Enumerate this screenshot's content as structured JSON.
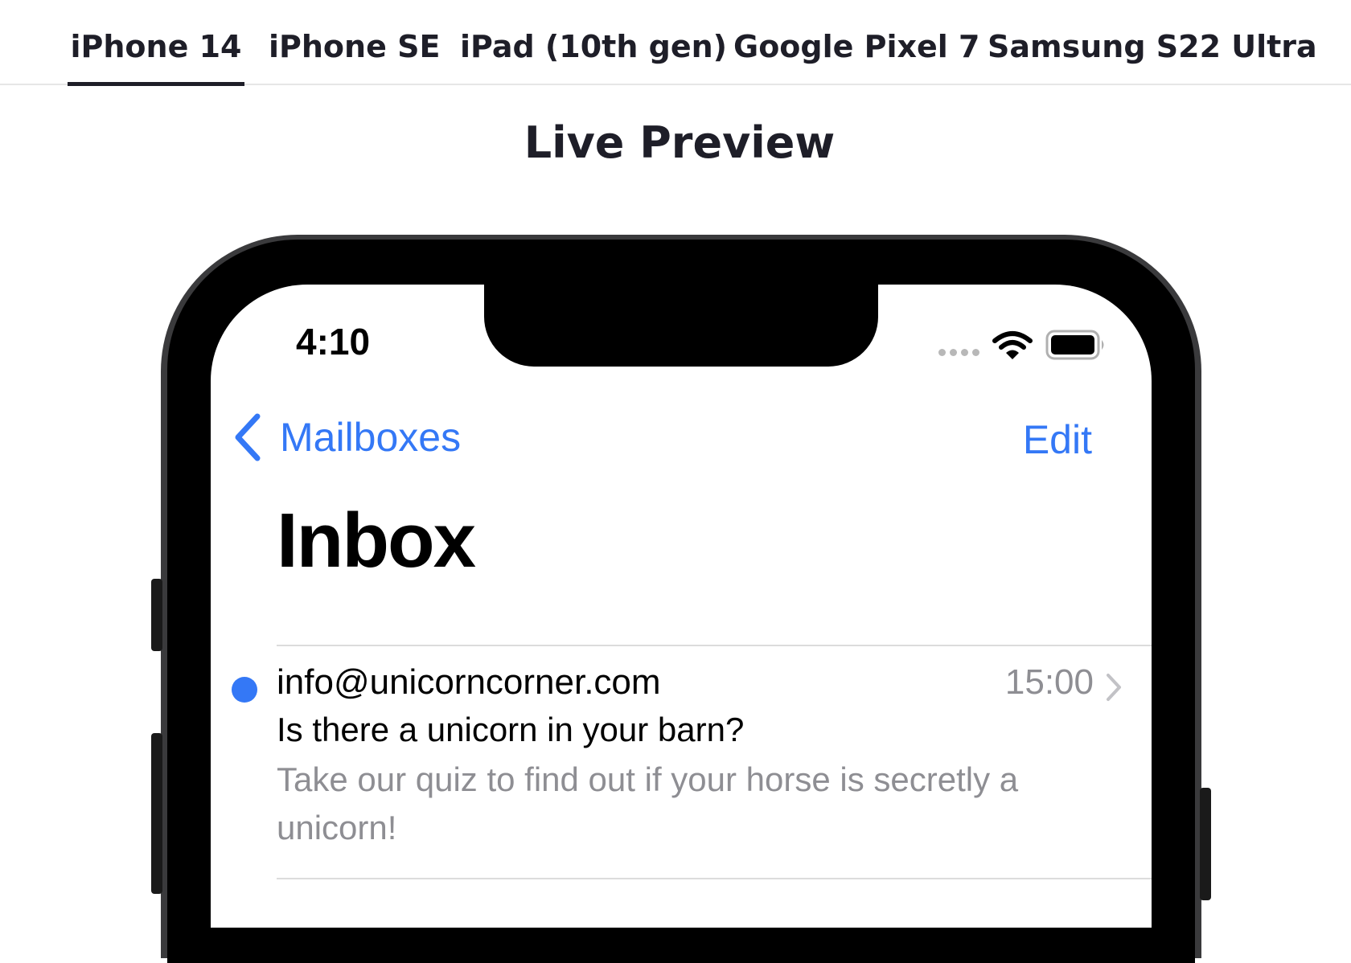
{
  "device_tabs": [
    {
      "label": "iPhone 14",
      "active": true
    },
    {
      "label": "iPhone SE",
      "active": false
    },
    {
      "label": "iPad (10th gen)",
      "active": false
    },
    {
      "label": "Google Pixel 7",
      "active": false
    },
    {
      "label": "Samsung S22 Ultra",
      "active": false
    }
  ],
  "page_title": "Live Preview",
  "phone": {
    "status_bar": {
      "time": "4:10",
      "icons": [
        "signal-dots-icon",
        "wifi-icon",
        "battery-icon"
      ]
    },
    "nav": {
      "back_label": "Mailboxes",
      "edit_label": "Edit"
    },
    "title": "Inbox",
    "messages": [
      {
        "unread": true,
        "sender": "info@unicorncorner.com",
        "time": "15:00",
        "subject": "Is there a unicorn in your barn?",
        "preview": "Take our quiz to find out if your horse is secretly a unicorn!"
      }
    ]
  },
  "colors": {
    "accent": "#3478f6",
    "text_primary": "#000000",
    "text_secondary": "#8e8e93",
    "tab_text": "#1e1e28",
    "divider": "#dcdcdc"
  }
}
